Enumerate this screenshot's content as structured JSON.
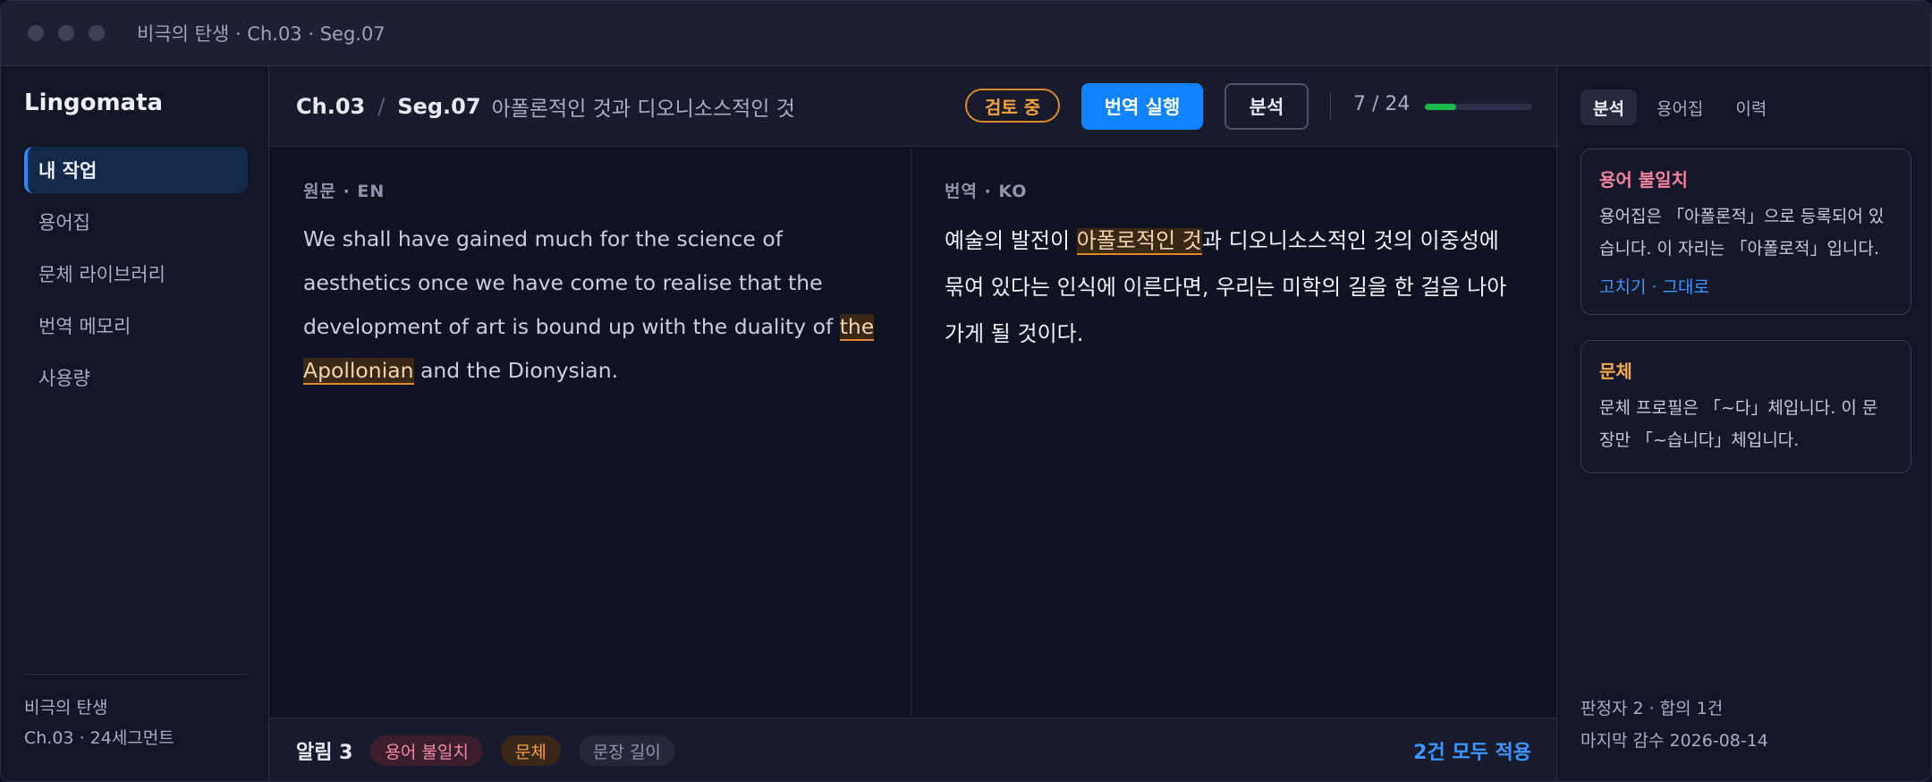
{
  "window": {
    "title": "비극의 탄생 · Ch.03 · Seg.07"
  },
  "sidebar": {
    "brand": "Lingomata",
    "items": [
      {
        "label": "내 작업",
        "active": true
      },
      {
        "label": "용어집"
      },
      {
        "label": "문체 라이브러리"
      },
      {
        "label": "번역 메모리"
      },
      {
        "label": "사용량"
      }
    ],
    "footer": {
      "line1": "비극의 탄생",
      "line2": "Ch.03 · 24세그먼트"
    }
  },
  "toolbar": {
    "chapter": "Ch.03",
    "separator": "/",
    "segment": "Seg.07",
    "segment_title": "아폴론적인 것과 디오니소스적인 것",
    "status": "검토 중",
    "run_label": "번역 실행",
    "analyze_label": "분석",
    "progress_text": "7 / 24",
    "progress_fraction": 0.2917
  },
  "source": {
    "label": "원문 · EN",
    "text_before": "We shall have gained much for the science of aesthetics once we have come to realise that the development of art is bound up with the duality of ",
    "highlight": "the Apollonian",
    "text_after": " and the Dionysian."
  },
  "target": {
    "label": "번역 · KO",
    "text_before": "예술의 발전이 ",
    "highlight": "아폴로적인 것",
    "text_after": "과 디오니소스적인 것의 이중성에 묶여 있다는 인식에 이른다면, 우리는 미학의 길을 한 걸음 나아가게 될 것이다."
  },
  "alerts": {
    "title": "알림 3",
    "chips": {
      "term": "용어 불일치",
      "style": "문체",
      "length": "문장 길이"
    },
    "apply_all": "2건 모두 적용"
  },
  "panel": {
    "tabs": [
      {
        "label": "분석",
        "active": true
      },
      {
        "label": "용어집"
      },
      {
        "label": "이력"
      }
    ],
    "term_card": {
      "title": "용어 불일치",
      "body": "용어집은 「아폴론적」으로 등록되어 있습니다. 이 자리는 「아폴로적」입니다.",
      "actions": "고치기 · 그대로"
    },
    "style_card": {
      "title": "문체",
      "body": "문체 프로필은 「~다」체입니다. 이 문장만 「~습니다」체입니다."
    },
    "footer": {
      "line1": "판정자 2 · 합의 1건",
      "line2": "마지막 감수 2026-08-14"
    }
  },
  "colors": {
    "accent": "#1283ff",
    "warning": "#e08a2e",
    "danger": "#f3839f",
    "success": "#18b84a"
  }
}
